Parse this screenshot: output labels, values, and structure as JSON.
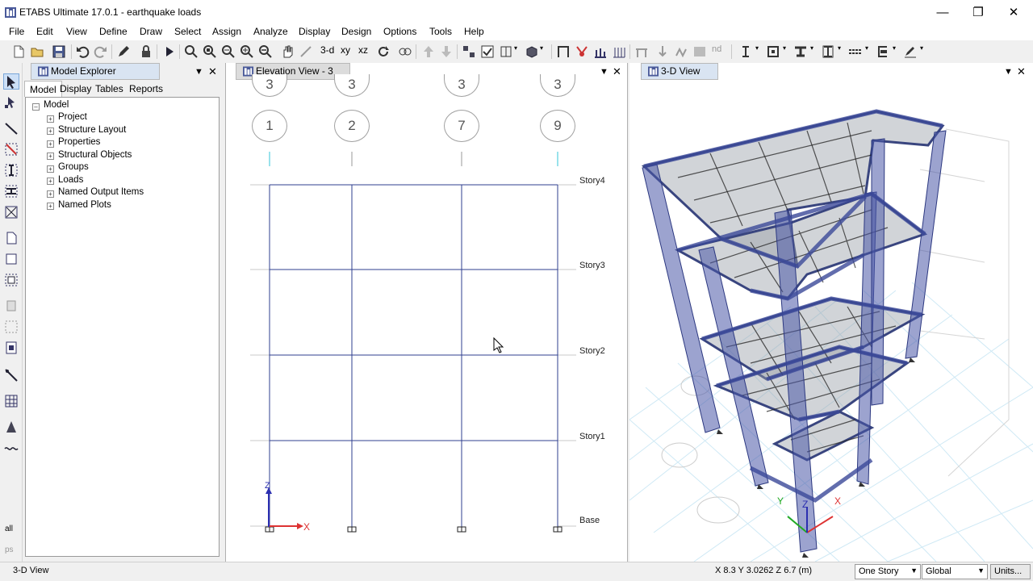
{
  "window": {
    "title": "ETABS Ultimate 17.0.1 - earthquake loads",
    "controls": [
      "minimize",
      "restore",
      "close"
    ]
  },
  "menu": [
    "File",
    "Edit",
    "View",
    "Define",
    "Draw",
    "Select",
    "Assign",
    "Analyze",
    "Display",
    "Design",
    "Options",
    "Tools",
    "Help"
  ],
  "toolbar": {
    "view_3d_label": "3-d",
    "view_plan_label": "xy",
    "view_elev_label": "xz",
    "label_nd": "nd",
    "icons": [
      "new-model-icon",
      "open-icon",
      "save-icon",
      "undo-icon",
      "redo-icon",
      "lock-icon",
      "run-analysis-icon",
      "zoom-rubber-icon",
      "zoom-restore-icon",
      "zoom-in-icon",
      "zoom-out-icon",
      "pan-icon",
      "rotate-3d-icon",
      "refresh-icon",
      "set-display-icon",
      "move-up-icon",
      "move-down-icon",
      "object-shrink-icon",
      "show-selected-icon",
      "perspective-icon",
      "extrude-icon",
      "frame-icon",
      "restraint-icon",
      "section-cut-icon",
      "grid-icon",
      "joint-icon",
      "load-icon",
      "display-icon",
      "text-icon",
      "shell-icon",
      "frame-design-icon",
      "section-icon",
      "line-icon",
      "clear-icon",
      "pen-icon"
    ]
  },
  "left_tools": [
    "pointer-icon",
    "reshape-icon",
    "draw-frame-icon",
    "draw-brace-icon",
    "draw-column-icon",
    "draw-beam-icon",
    "draw-cross-icon",
    "draw-floor-icon",
    "draw-wall-icon",
    "draw-opening-icon",
    "draw-pier-icon",
    "draw-spandrel-icon",
    "draw-link-icon",
    "draw-grid-icon",
    "draw-dimension-icon",
    "draw-tendon-icon",
    "select-all-icon",
    "select-previous-icon"
  ],
  "left_tools_labels": {
    "all": "all",
    "ps": "ps"
  },
  "explorer": {
    "title": "Model Explorer",
    "tabs": [
      "Model",
      "Display",
      "Tables",
      "Reports"
    ],
    "active_tab": "Model",
    "root": "Model",
    "items": [
      "Project",
      "Structure Layout",
      "Properties",
      "Structural Objects",
      "Groups",
      "Loads",
      "Named Output Items",
      "Named Plots"
    ]
  },
  "elevation": {
    "title": "Elevation View - 3",
    "row_bubbles": [
      "3",
      "3",
      "3",
      "3"
    ],
    "col_bubbles": [
      "1",
      "2",
      "7",
      "9"
    ],
    "stories": [
      "Story4",
      "Story3",
      "Story2",
      "Story1",
      "Base"
    ],
    "axis_z": "Z",
    "axis_x": "X"
  },
  "view3d": {
    "title": "3-D View",
    "axis_x": "X",
    "axis_y": "Y",
    "axis_z": "Z",
    "frame_color": "#4a57a8",
    "slab_color": "#b8b8b8"
  },
  "status": {
    "left": "3-D View",
    "coords": "X 8.3  Y 3.0262  Z 6.7 (m)",
    "story_select": "One Story",
    "coord_select": "Global",
    "units_button": "Units..."
  }
}
